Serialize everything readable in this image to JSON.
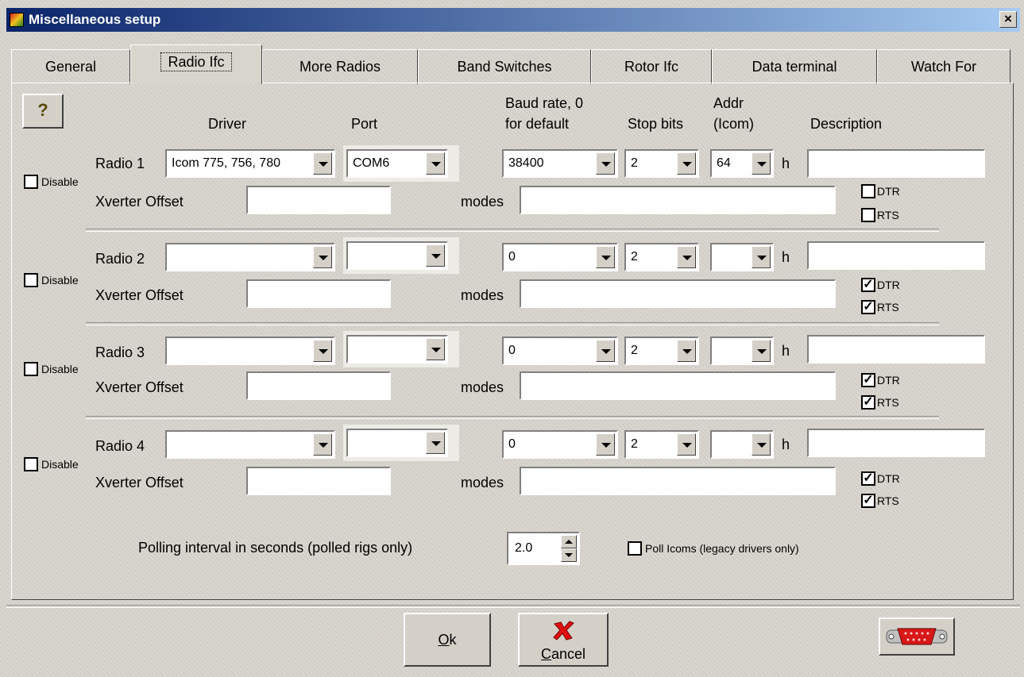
{
  "window": {
    "title": "Miscellaneous setup",
    "close_label": "×"
  },
  "tabs": [
    {
      "label": "General"
    },
    {
      "label": "Radio Ifc"
    },
    {
      "label": "More Radios"
    },
    {
      "label": "Band Switches"
    },
    {
      "label": "Rotor Ifc"
    },
    {
      "label": "Data terminal"
    },
    {
      "label": "Watch For"
    }
  ],
  "active_tab": "Radio Ifc",
  "help_button": {
    "label": "?"
  },
  "headers": {
    "driver": "Driver",
    "port": "Port",
    "baud_line1": "Baud rate, 0",
    "baud_line2": "for default",
    "stop_bits": "Stop bits",
    "addr_line1": "Addr",
    "addr_line2": "(Icom)",
    "description": "Description"
  },
  "common": {
    "disable_label": "Disable",
    "xverter_label": "Xverter Offset",
    "modes_label": "modes",
    "h_label": "h",
    "dtr_label": "DTR",
    "rts_label": "RTS"
  },
  "radios": [
    {
      "label": "Radio 1",
      "driver": "Icom 775, 756, 780",
      "port": "COM6",
      "baud": "38400",
      "stop_bits": "2",
      "addr": "64",
      "description": "",
      "xverter": "",
      "modes": "",
      "disable": false,
      "dtr": false,
      "rts": false
    },
    {
      "label": "Radio 2",
      "driver": "",
      "port": "",
      "baud": "0",
      "stop_bits": "2",
      "addr": "",
      "description": "",
      "xverter": "",
      "modes": "",
      "disable": false,
      "dtr": true,
      "rts": true
    },
    {
      "label": "Radio 3",
      "driver": "",
      "port": "",
      "baud": "0",
      "stop_bits": "2",
      "addr": "",
      "description": "",
      "xverter": "",
      "modes": "",
      "disable": false,
      "dtr": true,
      "rts": true
    },
    {
      "label": "Radio 4",
      "driver": "",
      "port": "",
      "baud": "0",
      "stop_bits": "2",
      "addr": "",
      "description": "",
      "xverter": "",
      "modes": "",
      "disable": false,
      "dtr": true,
      "rts": true
    }
  ],
  "polling": {
    "label": "Polling interval in seconds (polled rigs only)",
    "value": "2.0"
  },
  "poll_icoms": {
    "label": "Poll Icoms (legacy drivers only)",
    "checked": false
  },
  "buttons": {
    "ok": "Ok",
    "ok_mnemonic": "O",
    "cancel": "Cancel",
    "cancel_mnemonic": "C"
  }
}
